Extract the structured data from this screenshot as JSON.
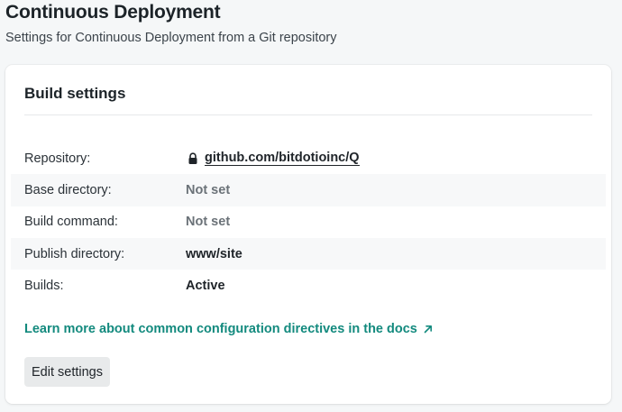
{
  "page": {
    "title": "Continuous Deployment",
    "subtitle": "Settings for Continuous Deployment from a Git repository"
  },
  "card": {
    "title": "Build settings",
    "rows": [
      {
        "label": "Repository:",
        "value": "github.com/bitdotioinc/Q",
        "icon": "lock-icon"
      },
      {
        "label": "Base directory:",
        "value": "Not set"
      },
      {
        "label": "Build command:",
        "value": "Not set"
      },
      {
        "label": "Publish directory:",
        "value": "www/site"
      },
      {
        "label": "Builds:",
        "value": "Active"
      }
    ],
    "docs_link": "Learn more about common configuration directives in the docs",
    "docs_link_icon": "external-arrow-icon",
    "edit_button": "Edit settings"
  },
  "colors": {
    "background": "#f5f7f8",
    "card": "#ffffff",
    "link_teal": "#138a7e",
    "muted_text": "#6b7278",
    "button_bg": "#e8eaeb"
  }
}
